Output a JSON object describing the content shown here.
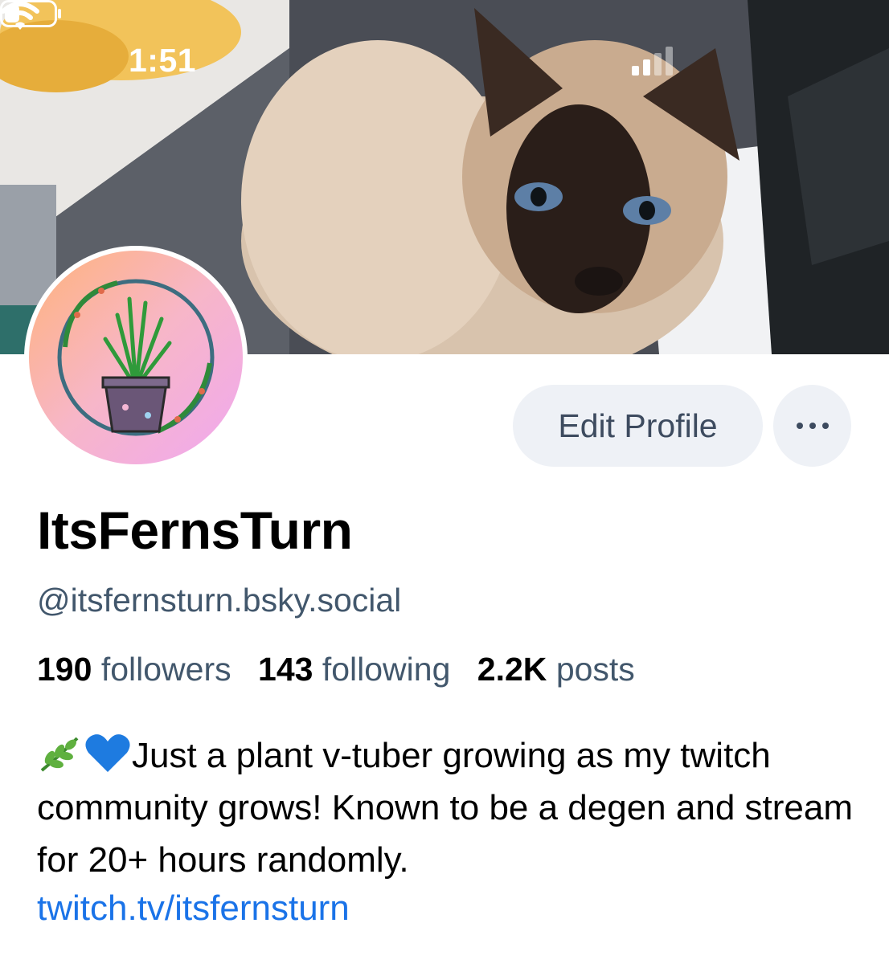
{
  "status_bar": {
    "time": "1:51"
  },
  "profile": {
    "display_name": "ItsFernsTurn",
    "handle": "@itsfernsturn.bsky.social",
    "stats": {
      "followers_count": "190",
      "followers_label": "followers",
      "following_count": "143",
      "following_label": "following",
      "posts_count": "2.2K",
      "posts_label": "posts"
    },
    "bio_text": "Just a plant v-tuber growing as my twitch community grows! Known to be a degen and stream for 20+ hours randomly.",
    "bio_link": "twitch.tv/itsfernsturn"
  },
  "actions": {
    "edit_profile_label": "Edit Profile"
  },
  "colors": {
    "button_bg": "#eef1f6",
    "secondary_text": "#42576c",
    "link": "#1a73e8"
  },
  "icons": {
    "more": "more-dots-icon",
    "signal": "cellular-signal-icon",
    "wifi": "wifi-icon",
    "battery": "battery-icon",
    "bio_emoji_1": "herb-emoji",
    "bio_emoji_2": "blue-heart-emoji"
  }
}
